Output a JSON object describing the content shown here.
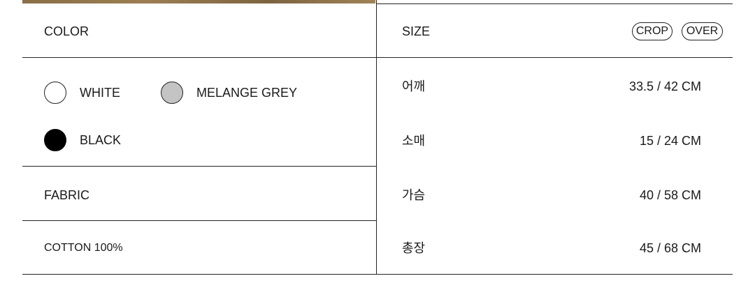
{
  "color_section": {
    "header": "COLOR",
    "options": [
      {
        "label": "WHITE",
        "swatch": "#ffffff"
      },
      {
        "label": "MELANGE GREY",
        "swatch": "#c4c4c4"
      },
      {
        "label": "BLACK",
        "swatch": "#000000"
      }
    ]
  },
  "fabric_section": {
    "header": "FABRIC",
    "value": "COTTON 100%"
  },
  "size_section": {
    "header": "SIZE",
    "tags": [
      "CROP",
      "OVER"
    ],
    "rows": [
      {
        "label": "어깨",
        "value": "33.5 / 42 CM"
      },
      {
        "label": "소매",
        "value": "15 / 24 CM"
      },
      {
        "label": "가슴",
        "value": "40 / 58 CM"
      },
      {
        "label": "총장",
        "value": "45 / 68 CM"
      }
    ]
  }
}
